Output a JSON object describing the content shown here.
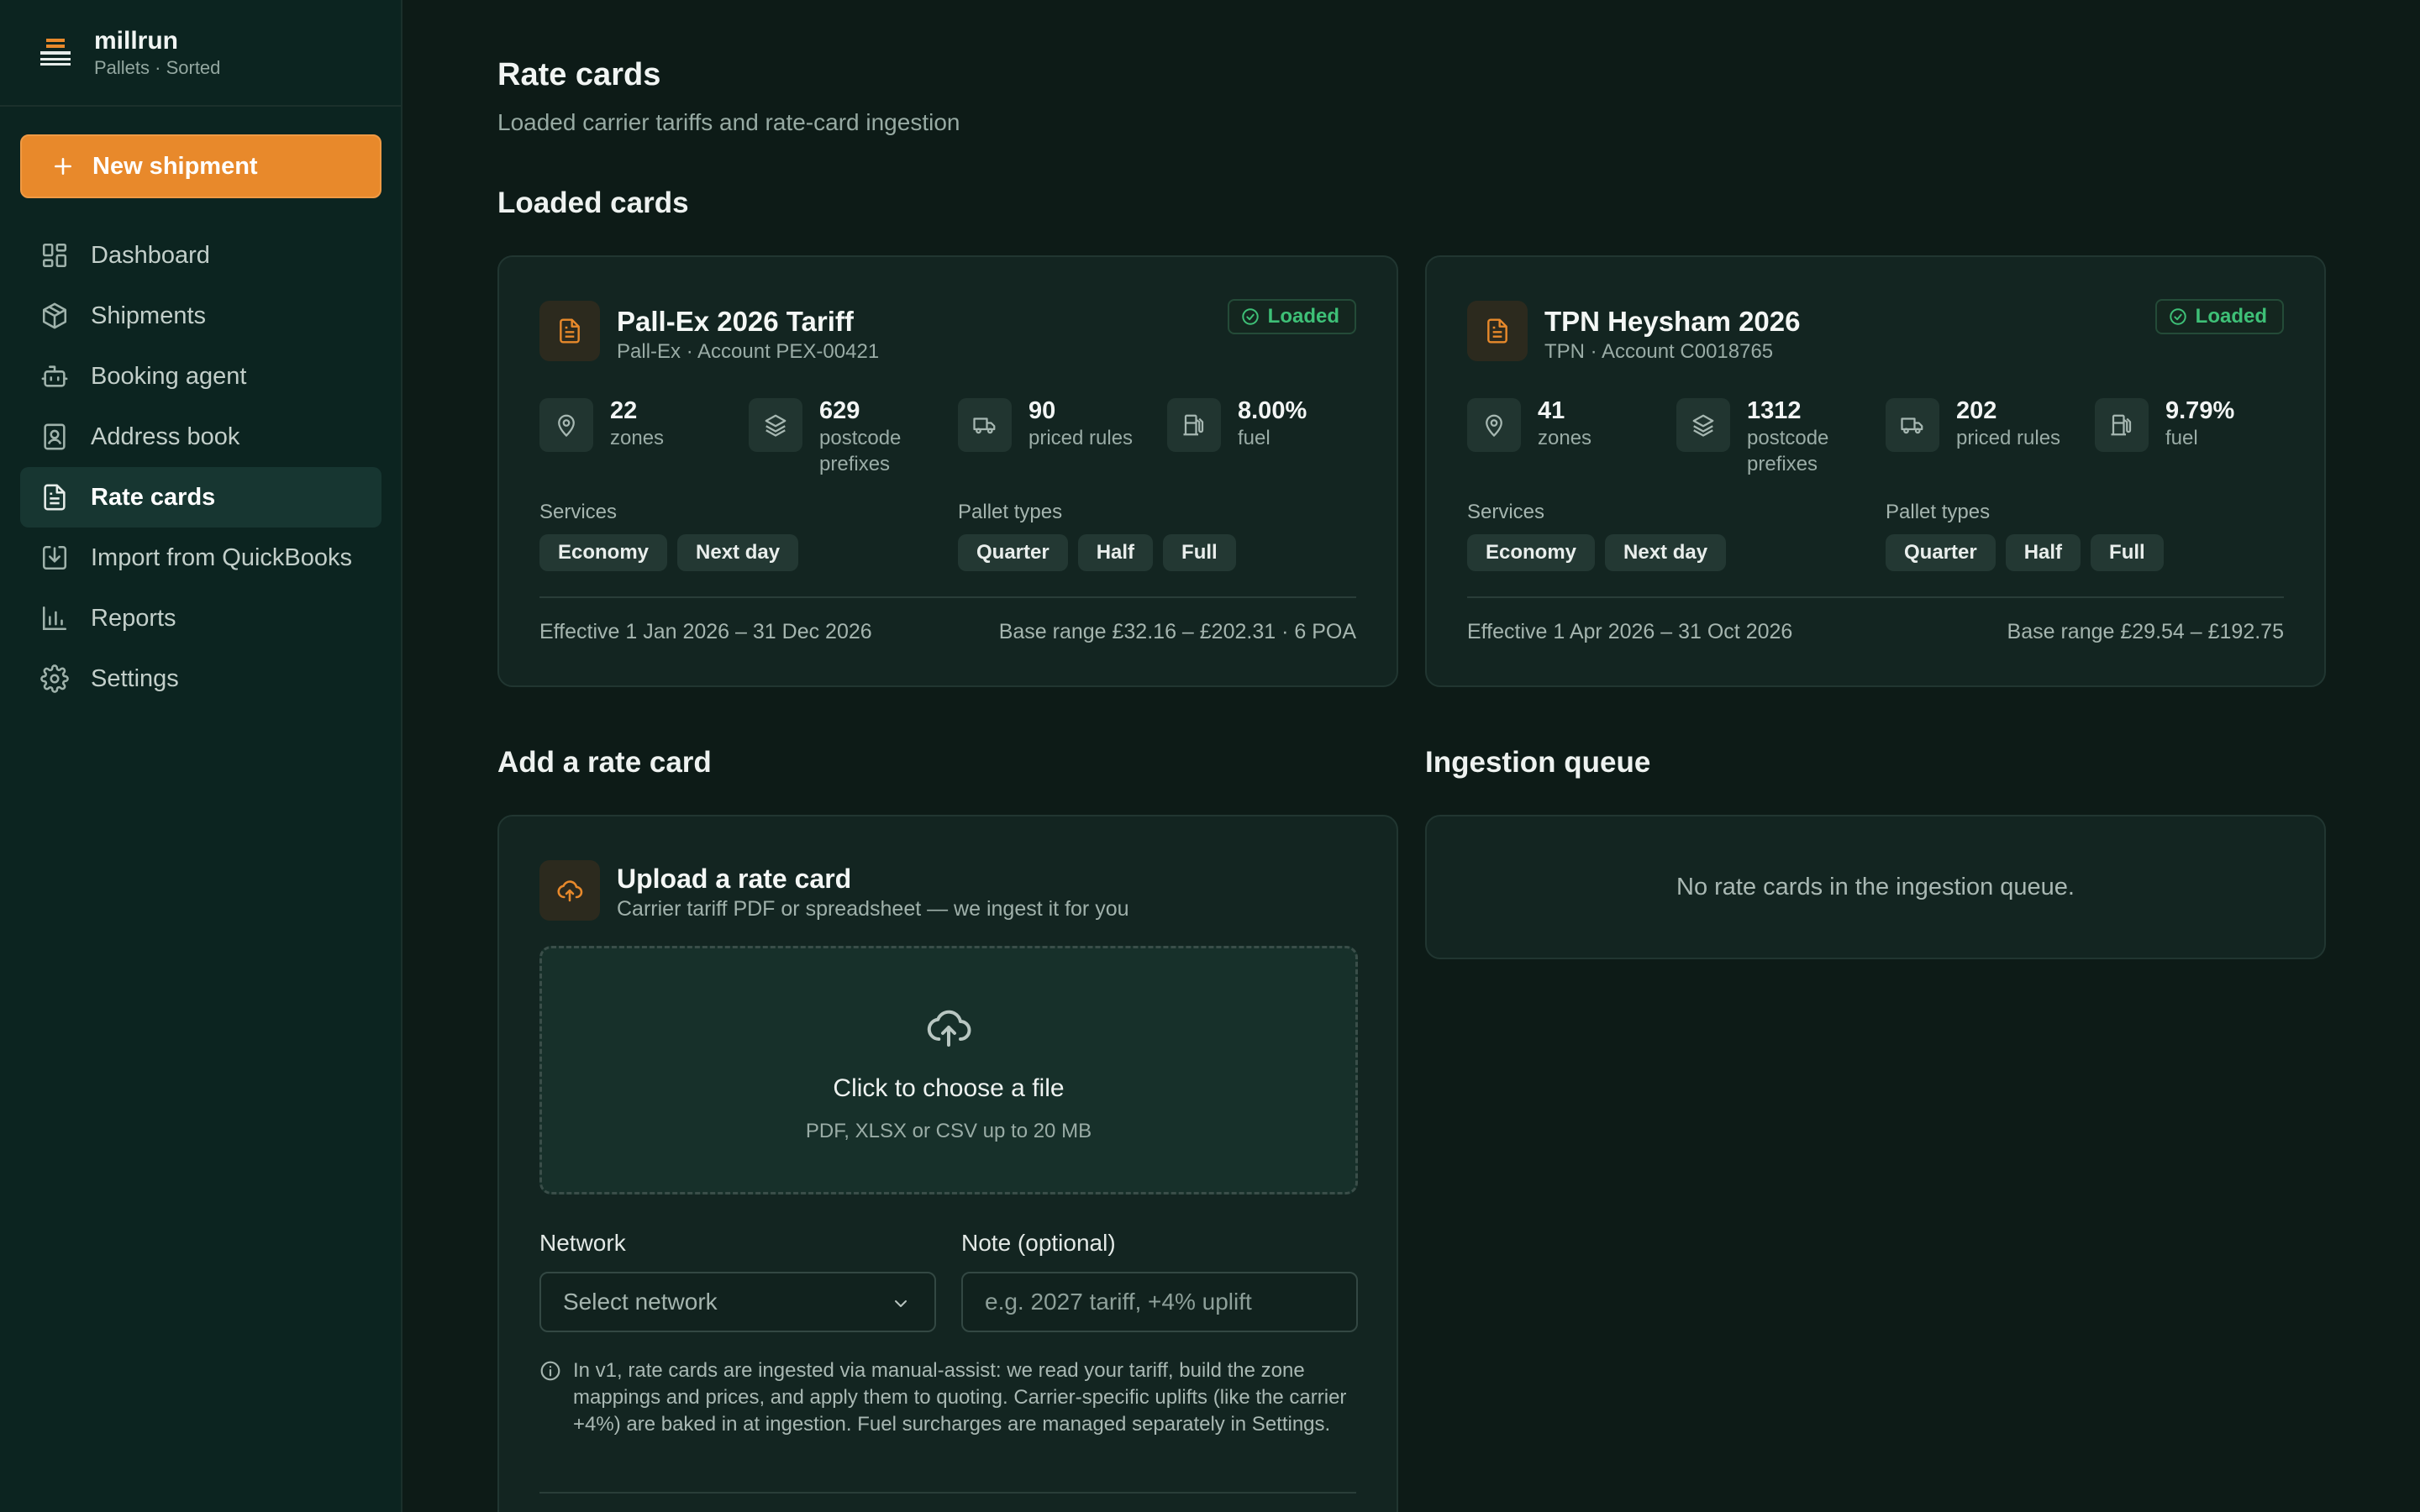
{
  "brand": {
    "name": "millrun",
    "tagline": "Pallets · Sorted"
  },
  "sidebar": {
    "new_button": "New shipment",
    "items": [
      {
        "label": "Dashboard",
        "icon": "grid-icon"
      },
      {
        "label": "Shipments",
        "icon": "box-icon"
      },
      {
        "label": "Booking agent",
        "icon": "robot-icon"
      },
      {
        "label": "Address book",
        "icon": "contact-icon"
      },
      {
        "label": "Rate cards",
        "icon": "file-text-icon",
        "active": true
      },
      {
        "label": "Import from QuickBooks",
        "icon": "import-icon"
      },
      {
        "label": "Reports",
        "icon": "bar-chart-icon"
      },
      {
        "label": "Settings",
        "icon": "gear-icon"
      }
    ]
  },
  "page": {
    "title": "Rate cards",
    "subtitle": "Loaded carrier tariffs and rate-card ingestion"
  },
  "loaded": {
    "section_title": "Loaded cards",
    "cards": [
      {
        "name": "Pall-Ex 2026 Tariff",
        "account": "Pall-Ex · Account PEX-00421",
        "status": "Loaded",
        "stats": [
          {
            "value": "22",
            "label": "zones"
          },
          {
            "value": "629",
            "label": "postcode prefixes"
          },
          {
            "value": "90",
            "label": "priced rules"
          },
          {
            "value": "8.00%",
            "label": "fuel"
          }
        ],
        "services_label": "Services",
        "services": [
          "Economy",
          "Next day"
        ],
        "pallets_label": "Pallet types",
        "pallets": [
          "Quarter",
          "Half",
          "Full"
        ],
        "effective": "Effective 1 Jan 2026 – 31 Dec 2026",
        "base_range": "Base range £32.16 – £202.31 · 6 POA"
      },
      {
        "name": "TPN Heysham 2026",
        "account": "TPN · Account C0018765",
        "status": "Loaded",
        "stats": [
          {
            "value": "41",
            "label": "zones"
          },
          {
            "value": "1312",
            "label": "postcode prefixes"
          },
          {
            "value": "202",
            "label": "priced rules"
          },
          {
            "value": "9.79%",
            "label": "fuel"
          }
        ],
        "services_label": "Services",
        "services": [
          "Economy",
          "Next day"
        ],
        "pallets_label": "Pallet types",
        "pallets": [
          "Quarter",
          "Half",
          "Full"
        ],
        "effective": "Effective 1 Apr 2026 – 31 Oct 2026",
        "base_range": "Base range £29.54 – £192.75"
      }
    ]
  },
  "add": {
    "section_title": "Add a rate card",
    "upload_title": "Upload a rate card",
    "upload_subtitle": "Carrier tariff PDF or spreadsheet — we ingest it for you",
    "dropzone_title": "Click to choose a file",
    "dropzone_hint": "PDF, XLSX or CSV up to 20 MB",
    "network_label": "Network",
    "network_value": "Select network",
    "note_label": "Note (optional)",
    "note_placeholder": "e.g. 2027 tariff, +4% uplift",
    "info": "In v1, rate cards are ingested via manual-assist: we read your tariff, build the zone mappings and prices, and apply them to quoting. Carrier-specific uplifts (like the carrier +4%) are baked in at ingestion. Fuel surcharges are managed separately in Settings."
  },
  "queue": {
    "section_title": "Ingestion queue",
    "empty": "No rate cards in the ingestion queue."
  },
  "colors": {
    "accent": "#e8892b",
    "success": "#3ec077",
    "background": "#0d1b17",
    "sidebar": "#0c2420"
  }
}
